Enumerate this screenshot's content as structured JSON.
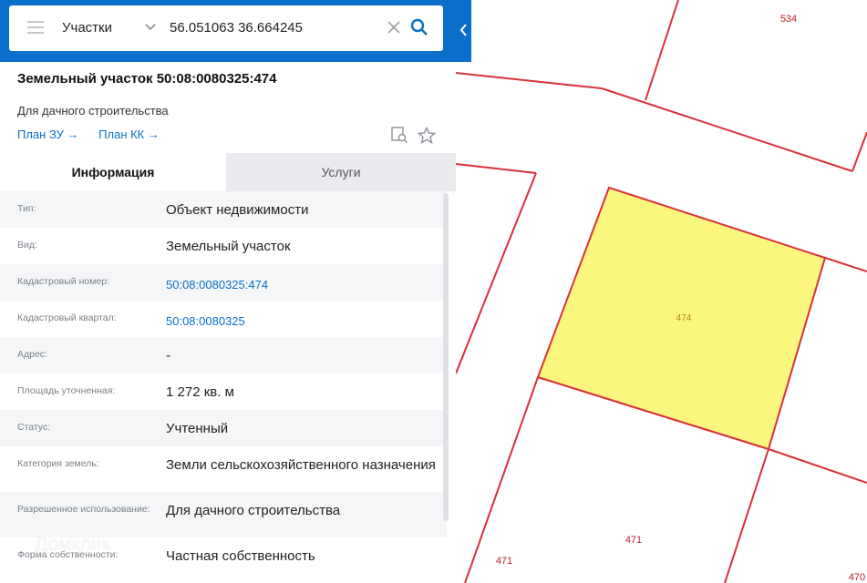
{
  "search": {
    "type_label": "Участки",
    "query": "56.051063 36.664245"
  },
  "parcel": {
    "title": "Земельный участок 50:08:0080325:474",
    "subtitle": "Для дачного строительства",
    "links": [
      "План ЗУ →",
      "План КК →"
    ]
  },
  "tabs": [
    "Информация",
    "Услуги"
  ],
  "rows": [
    {
      "label": "Тип:",
      "value": "Объект недвижимости",
      "link": false
    },
    {
      "label": "Вид:",
      "value": "Земельный участок",
      "link": false
    },
    {
      "label": "Кадастровый номер:",
      "value": "50:08:0080325:474",
      "link": true
    },
    {
      "label": "Кадастровый квартал:",
      "value": "50:08:0080325",
      "link": true
    },
    {
      "label": "Адрес:",
      "value": "-",
      "link": false
    },
    {
      "label": "Площадь уточненная:",
      "value": "1 272 кв. м",
      "link": false
    },
    {
      "label": "Статус:",
      "value": "Учтенный",
      "link": false
    },
    {
      "label": "Категория земель:",
      "value": "Земли сельскохозяйственного назначения",
      "link": false
    },
    {
      "label": "Разрешенное использование:",
      "value": "Для дачного строительства",
      "link": false
    },
    {
      "label": "Форма собственности:",
      "value": "Частная собственность",
      "link": false
    }
  ],
  "map": {
    "parcel_labels": [
      "534",
      "474",
      "471",
      "471",
      "470"
    ],
    "selected_fill": "#fbf77e",
    "boundary_color": "#d9303a"
  },
  "watermark": "Домклик",
  "colors": {
    "brand": "#0a6fcb"
  }
}
